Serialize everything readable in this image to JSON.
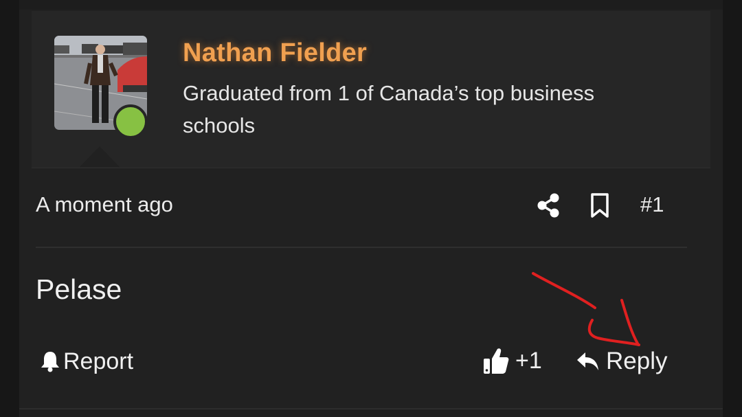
{
  "post": {
    "author": {
      "name": "Nathan Fielder",
      "title": "Graduated from 1 of Canada’s top business schools",
      "online": true,
      "name_color": "#f0a050",
      "online_color": "#87c143"
    },
    "timestamp": "A moment ago",
    "number": "#1",
    "message": "Pelase"
  },
  "actions": {
    "report_label": "Report",
    "like_count": "+1",
    "reply_label": "Reply"
  },
  "icons": [
    "share-icon",
    "bookmark-icon",
    "bell-icon",
    "thumbs-up-icon",
    "reply-icon"
  ]
}
